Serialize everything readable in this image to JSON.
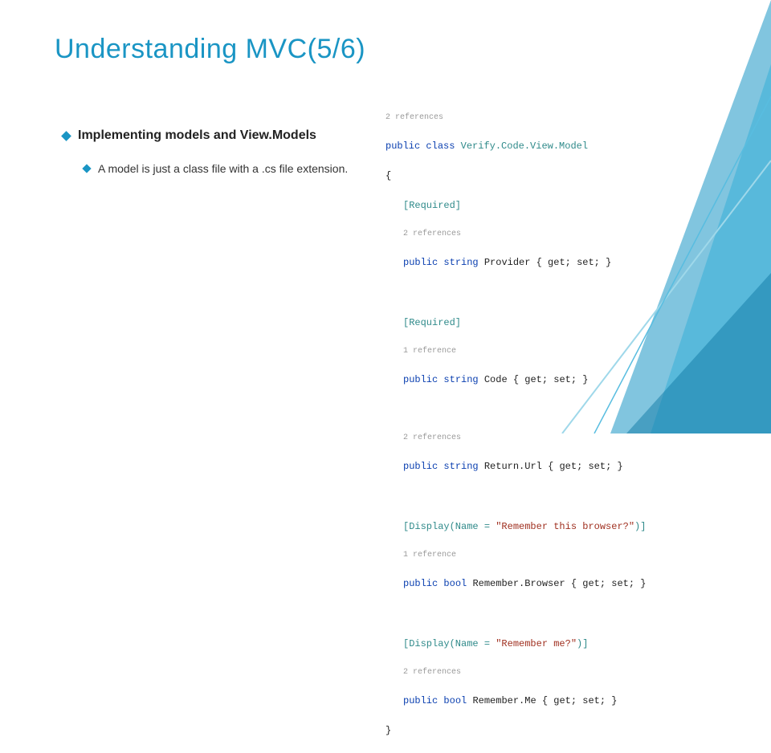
{
  "title": "Understanding MVC(5/6)",
  "bullets": {
    "b1": "Implementing models and View.Models",
    "b2": "A model is just a class file with a .cs file extension."
  },
  "code": {
    "refs2": "2 references",
    "refs1": "1 reference",
    "sig": {
      "pub": "public",
      "cls": "class",
      "name": "Verify.Code.View.Model"
    },
    "openBrace": "{",
    "closeBrace": "}",
    "attrRequired": "[Required]",
    "p1": {
      "pub": "public",
      "type": "string",
      "name": "Provider",
      "accessors": "{ get; set; }"
    },
    "p2": {
      "pub": "public",
      "type": "string",
      "name": "Code",
      "accessors": "{ get; set; }"
    },
    "p3": {
      "pub": "public",
      "type": "string",
      "name": "Return.Url",
      "accessors": "{ get; set; }"
    },
    "attrDisp1a": "[Display(Name = ",
    "attrDisp1s": "\"Remember this browser?\"",
    "attrDisp1b": ")]",
    "p4": {
      "pub": "public",
      "type": "bool",
      "name": "Remember.Browser",
      "accessors": "{ get; set; }"
    },
    "attrDisp2a": "[Display(Name = ",
    "attrDisp2s": "\"Remember me?\"",
    "attrDisp2b": ")]",
    "p5": {
      "pub": "public",
      "type": "bool",
      "name": "Remember.Me",
      "accessors": "{ get; set; }"
    }
  }
}
